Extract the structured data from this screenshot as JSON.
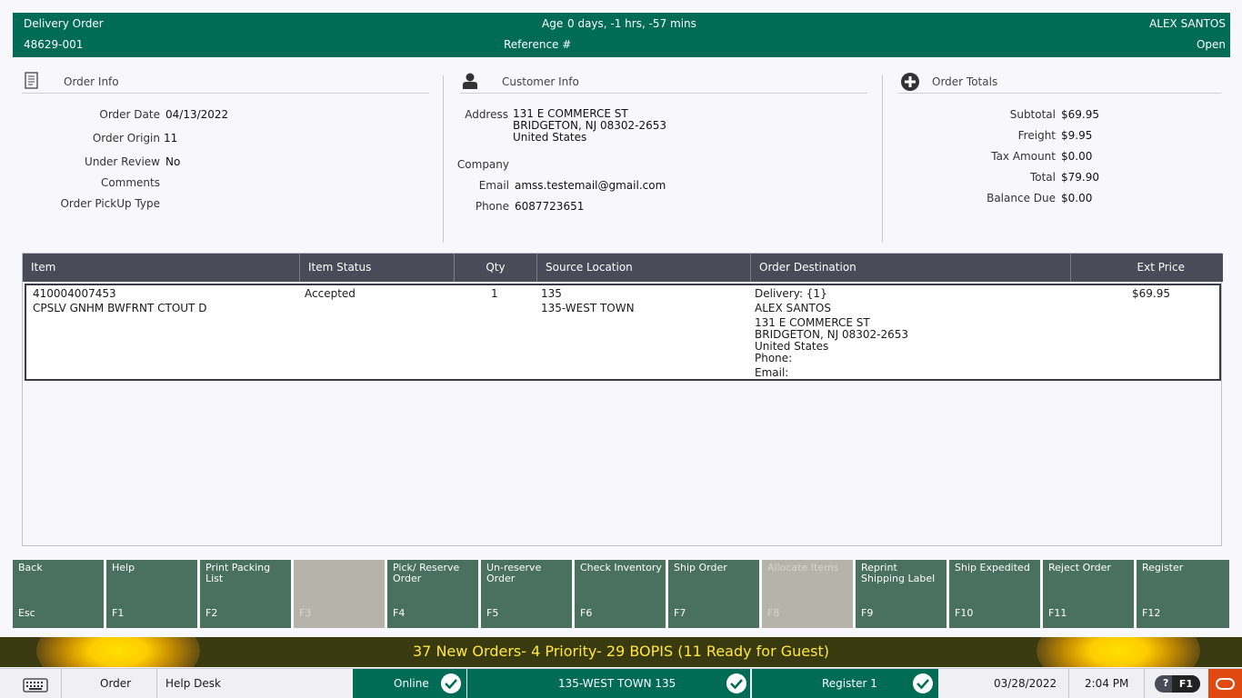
{
  "header": {
    "title": "Delivery Order",
    "order_number": "48629-001",
    "age_label": "Age",
    "age_value": "0 days, -1 hrs, -57 mins",
    "reference_label": "Reference #",
    "user": "ALEX SANTOS",
    "status": "Open"
  },
  "order_info": {
    "heading": "Order Info",
    "fields": [
      {
        "label": "Order Date",
        "value": "04/13/2022"
      },
      {
        "label": "Order Origin",
        "value": "11"
      },
      {
        "label": "Under Review",
        "value": "No"
      },
      {
        "label": "Comments",
        "value": ""
      },
      {
        "label": "Order PickUp Type",
        "value": ""
      }
    ]
  },
  "customer_info": {
    "heading": "Customer Info",
    "address_label": "Address",
    "address_lines": [
      "131 E COMMERCE ST",
      "BRIDGETON, NJ 08302-2653",
      "United States"
    ],
    "company_label": "Company",
    "company_value": "",
    "email_label": "Email",
    "email_value": "amss.testemail@gmail.com",
    "phone_label": "Phone",
    "phone_value": "6087723651"
  },
  "order_totals": {
    "heading": "Order Totals",
    "fields": [
      {
        "label": "Subtotal",
        "value": "$69.95"
      },
      {
        "label": "Freight",
        "value": "$9.95"
      },
      {
        "label": "Tax Amount",
        "value": "$0.00"
      },
      {
        "label": "Total",
        "value": "$79.90"
      },
      {
        "label": "Balance Due",
        "value": "$0.00"
      }
    ]
  },
  "table": {
    "columns": [
      "Item",
      "Item Status",
      "Qty",
      "Source Location",
      "Order Destination",
      "Ext Price"
    ],
    "rows": [
      {
        "item_code": "410004007453",
        "item_desc": "CPSLV GNHM BWFRNT CTOUT D",
        "status": "Accepted",
        "qty": "1",
        "source_code": "135",
        "source_name": "135-WEST TOWN",
        "dest_lines": [
          "Delivery: {1}",
          "ALEX SANTOS",
          "131 E COMMERCE ST",
          "BRIDGETON, NJ 08302-2653",
          "United States",
          "Phone:",
          "Email:"
        ],
        "ext_price": "$69.95"
      }
    ]
  },
  "function_keys": [
    {
      "label": "Back",
      "key": "Esc",
      "enabled": true
    },
    {
      "label": "Help",
      "key": "F1",
      "enabled": true
    },
    {
      "label": "Print Packing List",
      "key": "F2",
      "enabled": true
    },
    {
      "label": "",
      "key": "F3",
      "enabled": false
    },
    {
      "label": "Pick/ Reserve Order",
      "key": "F4",
      "enabled": true
    },
    {
      "label": "Un-reserve Order",
      "key": "F5",
      "enabled": true
    },
    {
      "label": "Check Inventory",
      "key": "F6",
      "enabled": true
    },
    {
      "label": "Ship Order",
      "key": "F7",
      "enabled": true
    },
    {
      "label": "Allocate Items",
      "key": "F8",
      "enabled": false
    },
    {
      "label": "Reprint Shipping Label",
      "key": "F9",
      "enabled": true
    },
    {
      "label": "Ship Expedited",
      "key": "F10",
      "enabled": true
    },
    {
      "label": "Reject Order",
      "key": "F11",
      "enabled": true
    },
    {
      "label": "Register",
      "key": "F12",
      "enabled": true
    }
  ],
  "banner": {
    "message": "37 New Orders- 4 Priority- 29 BOPIS (11 Ready for Guest)"
  },
  "status_bar": {
    "keyboard_icon": "keyboard-icon",
    "mode": "Order",
    "help_desk": "Help Desk",
    "online": "Online",
    "store": "135-WEST TOWN 135",
    "register": "Register 1",
    "date": "03/28/2022",
    "time": "2:04 PM",
    "help_key": "F1"
  },
  "colors": {
    "header_green": "#006c56",
    "fkey_green": "#4a7060",
    "fkey_disabled": "#b5b3aa",
    "table_header": "#4a4a58",
    "banner_text": "#ffe640",
    "oracle_red": "#e04a10"
  }
}
